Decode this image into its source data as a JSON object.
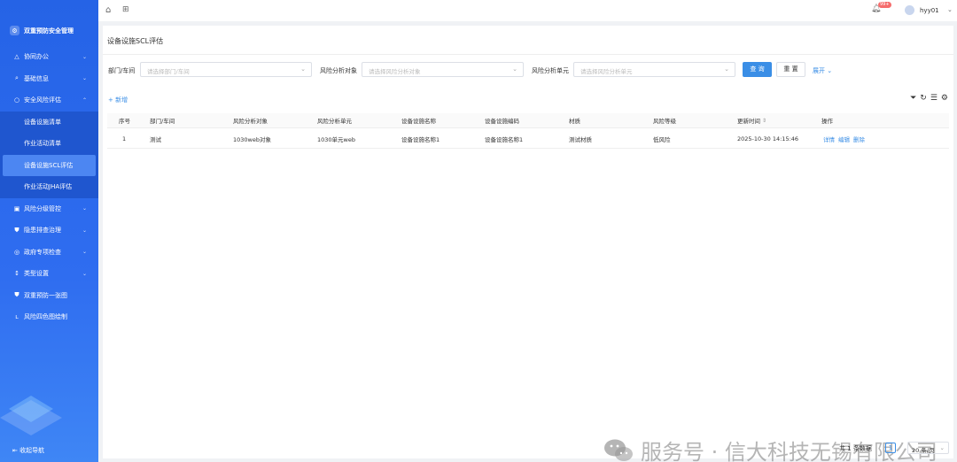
{
  "sidebar": {
    "brand": "双重预防安全管理",
    "items": [
      {
        "label": "协同办公",
        "icon": "△",
        "chevron": "⌄"
      },
      {
        "label": "基础信息",
        "icon": "🔍",
        "chevron": "⌄"
      },
      {
        "label": "安全风险评估",
        "icon": "○",
        "chevron": "⌃"
      }
    ],
    "subitems": [
      {
        "label": "设备设施清单"
      },
      {
        "label": "作业活动清单"
      },
      {
        "label": "设备设施SCL评估"
      },
      {
        "label": "作业活动JHA评估"
      }
    ],
    "items2": [
      {
        "label": "风险分级管控",
        "icon": "▣",
        "chevron": "⌄"
      },
      {
        "label": "隐患排查治理",
        "icon": "⛊",
        "chevron": "⌄"
      },
      {
        "label": "政府专项检查",
        "icon": "◎",
        "chevron": "⌄"
      },
      {
        "label": "类型设置",
        "icon": "↕",
        "chevron": "⌄"
      },
      {
        "label": "双重预防一张图",
        "icon": "⛊",
        "chevron": ""
      },
      {
        "label": "风险四色图绘制",
        "icon": "ʟ",
        "chevron": ""
      }
    ],
    "collapse": "收起导航"
  },
  "topbar": {
    "badge": "99+",
    "username": "hyy01"
  },
  "page": {
    "title": "设备设施SCL评估"
  },
  "filters": [
    {
      "label": "部门/车间",
      "placeholder": "请选择部门/车间"
    },
    {
      "label": "风险分析对象",
      "placeholder": "请选择风险分析对象"
    },
    {
      "label": "风险分析单元",
      "placeholder": "请选择风险分析单元"
    }
  ],
  "buttons": {
    "query": "查 询",
    "reset": "重 置",
    "expand": "展开"
  },
  "add_label": "新增",
  "table": {
    "columns": [
      "序号",
      "部门/车间",
      "风险分析对象",
      "风险分析单元",
      "设备设施名称",
      "设备设施编码",
      "材质",
      "风险等级",
      "更新时间",
      "操作"
    ],
    "rows": [
      [
        "1",
        "测试",
        "1030web对象",
        "1030单元web",
        "设备设施名称1",
        "设备设施名称1",
        "测试材质",
        "低风险",
        "2025-10-30 14:15:46"
      ]
    ],
    "actions": [
      "详情",
      "编辑",
      "删除"
    ]
  },
  "pagination": {
    "total": "共 1 条数据",
    "current": "1",
    "page_size": "20 条/页"
  },
  "watermark": "服务号 · 信大科技无锡有限公司",
  "colors": {
    "sidebar": "#2563e6",
    "primary": "#3a8ee6",
    "badge": "#f56c6c"
  }
}
